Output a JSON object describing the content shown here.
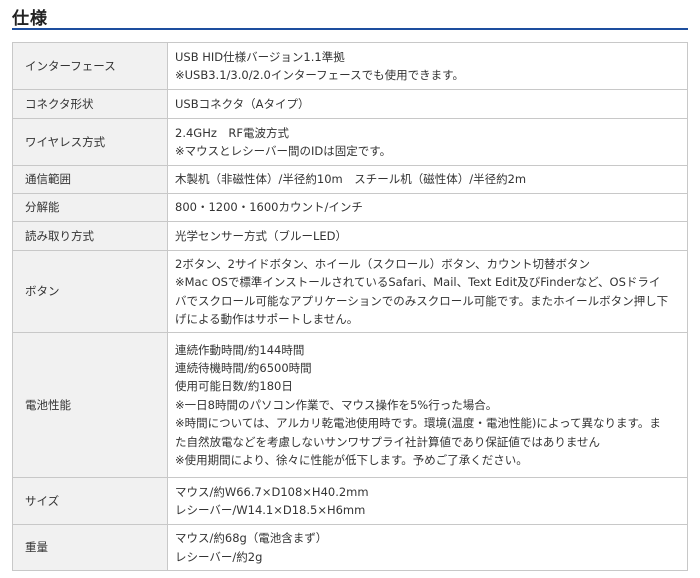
{
  "section": {
    "title": "仕様"
  },
  "rows": [
    {
      "label": "インターフェース",
      "lines": [
        "USB HID仕様バージョン1.1準拠",
        "※USB3.1/3.0/2.0インターフェースでも使用できます。"
      ]
    },
    {
      "label": "コネクタ形状",
      "lines": [
        "USBコネクタ（Aタイプ）"
      ]
    },
    {
      "label": "ワイヤレス方式",
      "lines": [
        "2.4GHz　RF電波方式",
        "※マウスとレシーバー間のIDは固定です。"
      ]
    },
    {
      "label": "通信範囲",
      "lines": [
        "木製机（非磁性体）/半径約10m　スチール机（磁性体）/半径約2m"
      ]
    },
    {
      "label": "分解能",
      "lines": [
        "800・1200・1600カウント/インチ"
      ]
    },
    {
      "label": "読み取り方式",
      "lines": [
        "光学センサー方式（ブルーLED）"
      ]
    },
    {
      "label": "ボタン",
      "lines": [
        "2ボタン、2サイドボタン、ホイール（スクロール）ボタン、カウント切替ボタン",
        "※Mac OSで標準インストールされているSafari、Mail、Text Edit及びFinderなど、OSドライ",
        "バでスクロール可能なアプリケーションでのみスクロール可能です。またホイールボタン押し下",
        "げによる動作はサポートしません。"
      ]
    },
    {
      "label": "電池性能",
      "lines": [
        "連続作動時間/約144時間",
        "連続待機時間/約6500時間",
        "使用可能日数/約180日",
        "※一日8時間のパソコン作業で、マウス操作を5%行った場合。",
        "※時間については、アルカリ乾電池使用時です。環境(温度・電池性能)によって異なります。ま",
        "た自然放電などを考慮しないサンワサプライ社計算値であり保証値ではありません",
        "※使用期間により、徐々に性能が低下します。予めご了承ください。"
      ]
    },
    {
      "label": "サイズ",
      "lines": [
        "マウス/約W66.7×D108×H40.2mm",
        "レシーバー/W14.1×D18.5×H6mm"
      ]
    },
    {
      "label": "重量",
      "lines": [
        "マウス/約68g（電池含まず）",
        "レシーバー/約2g"
      ]
    }
  ]
}
